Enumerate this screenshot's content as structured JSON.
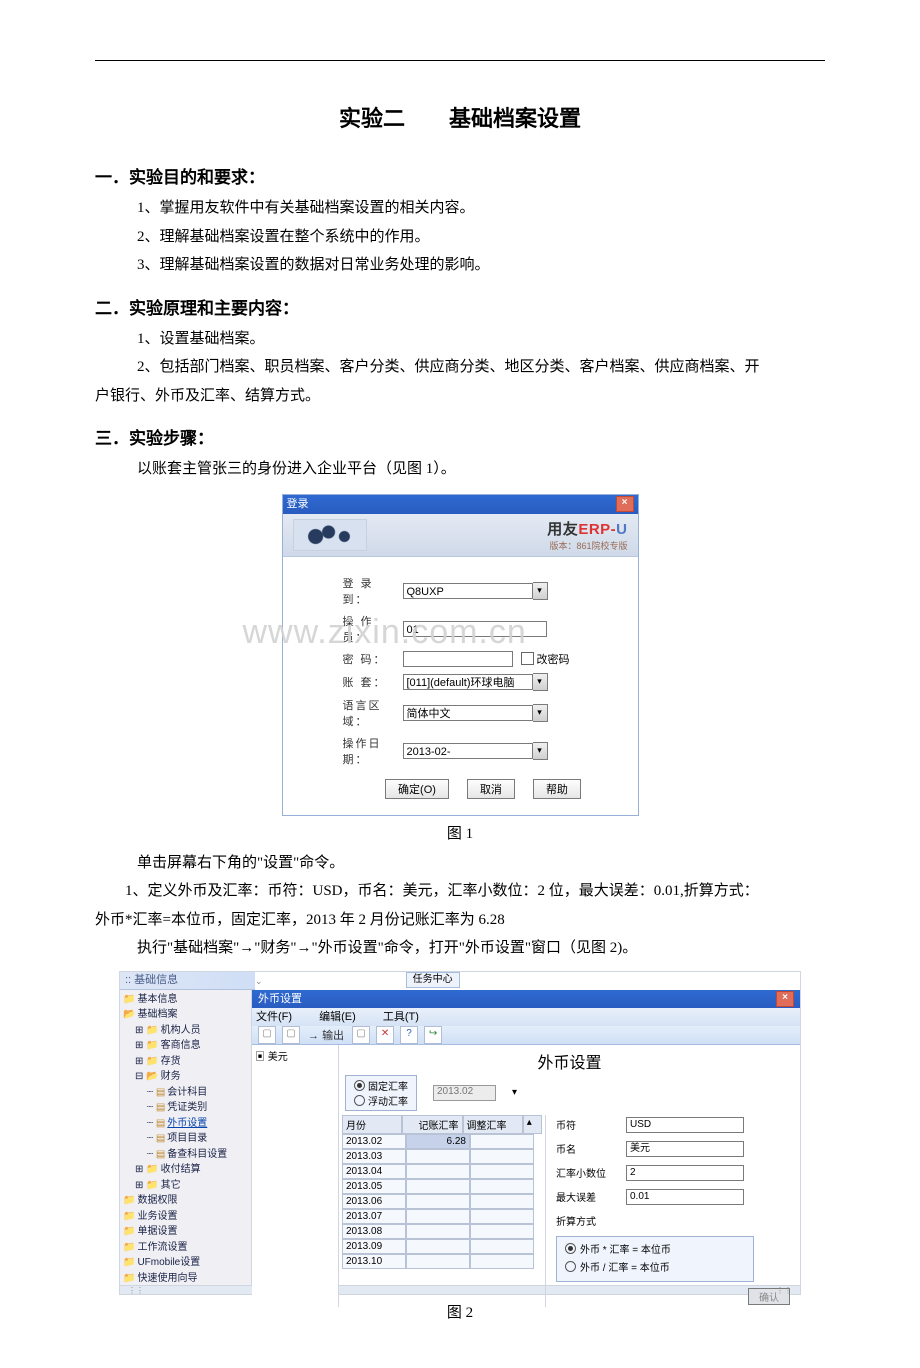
{
  "title": "实验二　　基础档案设置",
  "sec1": {
    "heading": "一．实验目的和要求：",
    "items": [
      "1、掌握用友软件中有关基础档案设置的相关内容。",
      "2、理解基础档案设置在整个系统中的作用。",
      "3、理解基础档案设置的数据对日常业务处理的影响。"
    ]
  },
  "sec2": {
    "heading": "二．实验原理和主要内容：",
    "line1": "1、设置基础档案。",
    "line2a": "2、包括部门档案、职员档案、客户分类、供应商分类、地区分类、客户档案、供应商档案、开",
    "line2b": "户银行、外币及汇率、结算方式。"
  },
  "sec3": {
    "heading": "三．实验步骤：",
    "intro": "以账套主管张三的身份进入企业平台（见图 1）。",
    "fig1_caption": "图 1",
    "after_fig1": "单击屏幕右下角的\"设置\"命令。",
    "step1a": "　　1、定义外币及汇率：币符：USD，币名：美元，汇率小数位：2 位，最大误差：0.01,折算方式：",
    "step1b": "外币*汇率=本位币，固定汇率，2013 年 2 月份记账汇率为 6.28",
    "step2": "执行\"基础档案\"→\"财务\"→\"外币设置\"命令，打开\"外币设置\"窗口（见图 2)。",
    "fig2_caption": "图 2"
  },
  "watermark": "www.zixin.com.cn",
  "login": {
    "title": "登录",
    "brand_cn": "用友",
    "brand_erp": "ERP-",
    "brand_u": "U",
    "version": "版本：861院校专版",
    "labels": {
      "server": "登 录 到：",
      "operator": "操 作 员：",
      "password": "密    码：",
      "account": "账    套：",
      "lang": "语言区域：",
      "date": "操作日期："
    },
    "values": {
      "server": "Q8UXP",
      "operator": "01",
      "password": "",
      "account": "[011](default)环球电脑",
      "lang": "简体中文",
      "date": "2013-02- "
    },
    "change_pw": "改密码",
    "buttons": {
      "ok": "确定(O)",
      "cancel": "取消",
      "help": "帮助"
    }
  },
  "currency_win": {
    "top_header": ":: 基础信息",
    "task_box": "任务中心",
    "tree": [
      {
        "lvl": 0,
        "icon": "folder",
        "label": "基本信息"
      },
      {
        "lvl": 0,
        "icon": "folder-open",
        "label": "基础档案"
      },
      {
        "lvl": 1,
        "icon": "folder",
        "label": "机构人员",
        "tree": "+"
      },
      {
        "lvl": 1,
        "icon": "folder",
        "label": "客商信息",
        "tree": "+"
      },
      {
        "lvl": 1,
        "icon": "folder",
        "label": "存货",
        "tree": "+"
      },
      {
        "lvl": 1,
        "icon": "folder-open",
        "label": "财务",
        "tree": "-"
      },
      {
        "lvl": 2,
        "icon": "doc",
        "label": "会计科目"
      },
      {
        "lvl": 2,
        "icon": "doc",
        "label": "凭证类别"
      },
      {
        "lvl": 2,
        "icon": "doc",
        "label": "外币设置",
        "sel": true
      },
      {
        "lvl": 2,
        "icon": "doc",
        "label": "项目目录"
      },
      {
        "lvl": 2,
        "icon": "doc",
        "label": "备查科目设置"
      },
      {
        "lvl": 1,
        "icon": "folder",
        "label": "收付结算",
        "tree": "+"
      },
      {
        "lvl": 1,
        "icon": "folder",
        "label": "其它",
        "tree": "+"
      },
      {
        "lvl": 0,
        "icon": "folder",
        "label": "数据权限"
      },
      {
        "lvl": 0,
        "icon": "folder",
        "label": "业务设置"
      },
      {
        "lvl": 0,
        "icon": "folder",
        "label": "单据设置"
      },
      {
        "lvl": 0,
        "icon": "folder",
        "label": "工作流设置"
      },
      {
        "lvl": 0,
        "icon": "folder",
        "label": "UFmobile设置"
      },
      {
        "lvl": 0,
        "icon": "folder",
        "label": "快速使用向导"
      }
    ],
    "module_title": "外币设置",
    "menus": {
      "file": "文件(F)",
      "edit": "编辑(E)",
      "tool": "工具(T)"
    },
    "toolbar_export": "输出",
    "currency_item": "美元",
    "big_title": "外币设置",
    "rate_type_fixed": "固定汇率",
    "rate_type_float": "浮动汇率",
    "month_value": "2013.02",
    "table_head": {
      "month": "月份",
      "rec": "记账汇率",
      "adj": "调整汇率"
    },
    "table_rows": [
      {
        "m": "2013.02",
        "r": "6.28",
        "a": ""
      },
      {
        "m": "2013.03",
        "r": "",
        "a": ""
      },
      {
        "m": "2013.04",
        "r": "",
        "a": ""
      },
      {
        "m": "2013.05",
        "r": "",
        "a": ""
      },
      {
        "m": "2013.06",
        "r": "",
        "a": ""
      },
      {
        "m": "2013.07",
        "r": "",
        "a": ""
      },
      {
        "m": "2013.08",
        "r": "",
        "a": ""
      },
      {
        "m": "2013.09",
        "r": "",
        "a": ""
      },
      {
        "m": "2013.10",
        "r": "",
        "a": ""
      }
    ],
    "fields": {
      "symbol_lbl": "币符",
      "symbol_val": "USD",
      "name_lbl": "币名",
      "name_val": "美元",
      "dec_lbl": "汇率小数位",
      "dec_val": "2",
      "err_lbl": "最大误差",
      "err_val": "0.01",
      "conv_lbl": "折算方式",
      "conv_opt1": "外币  *  汇率  =  本位币",
      "conv_opt2": "外币  /  汇率  =  本位币"
    },
    "confirm": "确认"
  }
}
